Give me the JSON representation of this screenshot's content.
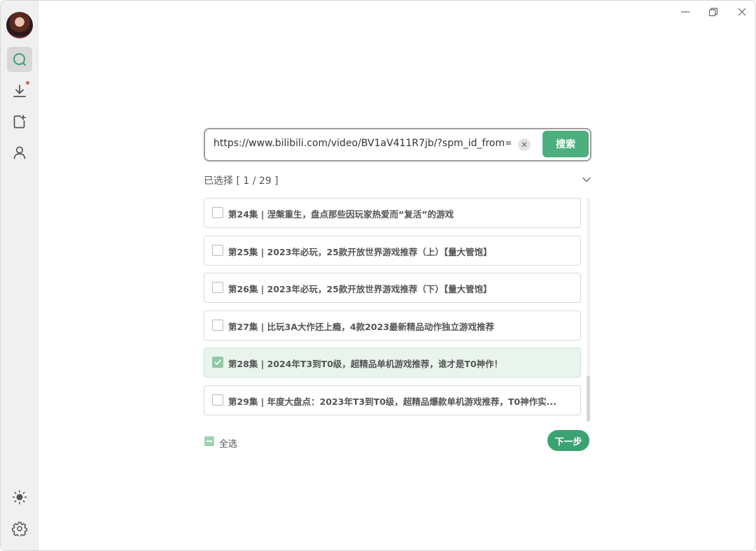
{
  "window": {
    "controls": {
      "minimize": "minimize-icon",
      "restore": "restore-icon",
      "close": "close-icon"
    }
  },
  "sidebar": {
    "items": [
      {
        "name": "search",
        "icon": "search-icon",
        "active": true
      },
      {
        "name": "download",
        "icon": "download-icon",
        "badge_dot": true
      },
      {
        "name": "add",
        "icon": "add-document-icon"
      },
      {
        "name": "user",
        "icon": "user-icon"
      }
    ],
    "bottom": [
      {
        "name": "theme",
        "icon": "sun-icon"
      },
      {
        "name": "settings",
        "icon": "gear-icon"
      }
    ]
  },
  "search": {
    "value": "https://www.bilibili.com/video/BV1aV411R7jb/?spm_id_from=",
    "button_label": "搜索"
  },
  "selection": {
    "label": "已选择 [ 1 / 29 ]"
  },
  "episodes": [
    {
      "label": "第24集 | 涅槃重生，盘点那些因玩家热爱而“复活”的游戏",
      "checked": false
    },
    {
      "label": "第25集 | 2023年必玩，25款开放世界游戏推荐（上）【量大管饱】",
      "checked": false
    },
    {
      "label": "第26集 | 2023年必玩，25款开放世界游戏推荐（下）【量大管饱】",
      "checked": false
    },
    {
      "label": "第27集 | 比玩3A大作还上瘾，4款2023最新精品动作独立游戏推荐",
      "checked": false
    },
    {
      "label": "第28集 | 2024年T3到T0级，超精品单机游戏推荐，谁才是T0神作！",
      "checked": true
    },
    {
      "label": "第29集 | 年度大盘点：2023年T3到T0级，超精品爆款单机游戏推荐，T0神作实...",
      "checked": false
    }
  ],
  "footer": {
    "select_all_label": "全选",
    "next_label": "下一步"
  },
  "colors": {
    "accent": "#4caf7d",
    "accent_dark": "#3aa371",
    "checked_bg": "#e8f4ec",
    "badge": "#e8594a"
  }
}
